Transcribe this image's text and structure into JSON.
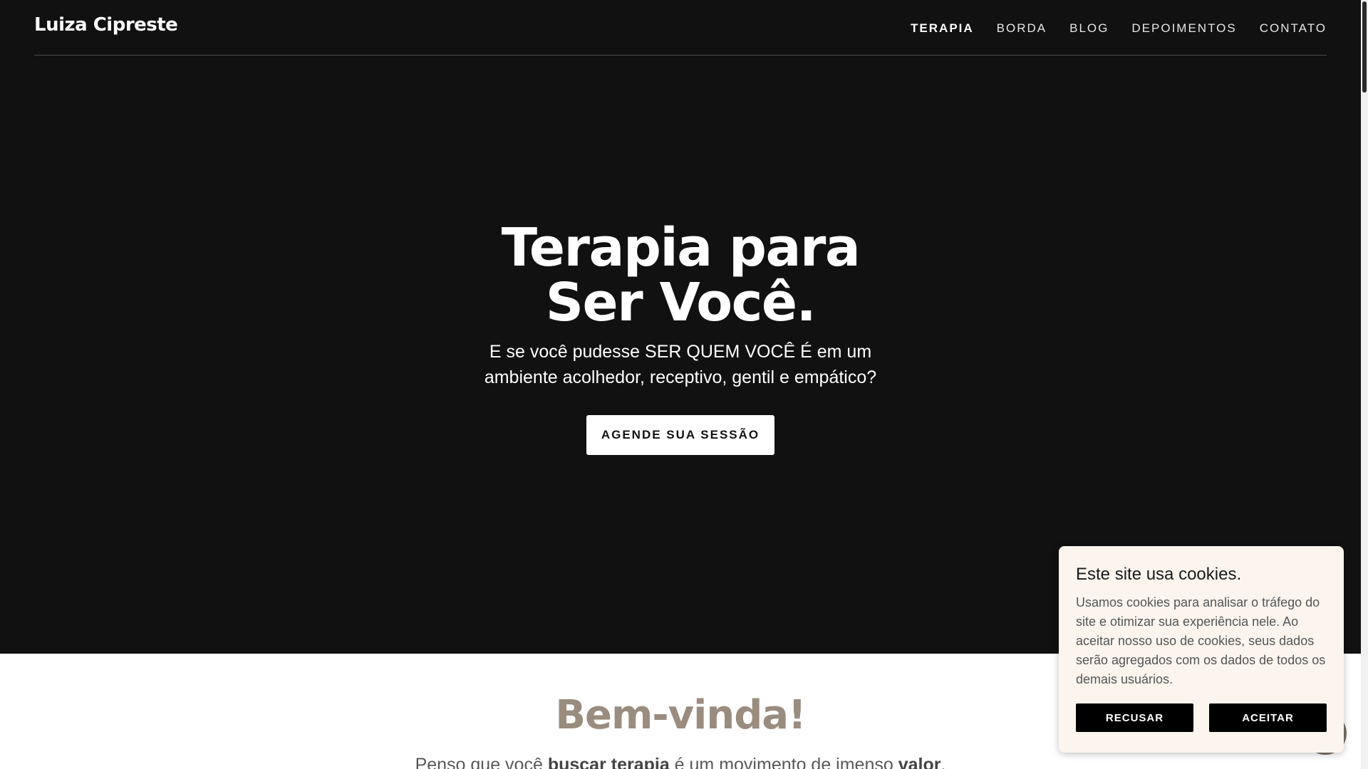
{
  "header": {
    "logo": "Luiza Cipreste",
    "nav": [
      {
        "label": "TERAPIA",
        "active": true
      },
      {
        "label": "BORDA"
      },
      {
        "label": "BLOG"
      },
      {
        "label": "DEPOIMENTOS"
      },
      {
        "label": "CONTATO"
      }
    ]
  },
  "hero": {
    "title_line1": "Terapia para",
    "title_line2": "Ser Você.",
    "subtitle": "E se você pudesse SER QUEM VOCÊ É em um ambiente acolhedor, receptivo, gentil e empático?",
    "cta_label": "AGENDE SUA SESSÃO"
  },
  "welcome": {
    "title": "Bem-vinda!",
    "text_part1": "Penso que você ",
    "text_bold1": "buscar terapia",
    "text_part2": " é um movimento de imenso ",
    "text_bold2": "valor",
    "text_part3": "."
  },
  "cookie_banner": {
    "title": "Este site usa cookies.",
    "text": "Usamos cookies para analisar o tráfego do site e otimizar sua experiência nele. Ao aceitar nosso uso de cookies, seus dados serão agregados com os dados de todos os demais usuários.",
    "decline_label": "RECUSAR",
    "accept_label": "ACEITAR"
  },
  "colors": {
    "hero_bg": "#111111",
    "accent": "#9a8c7e",
    "cookie_bg": "#fbf5ee"
  }
}
